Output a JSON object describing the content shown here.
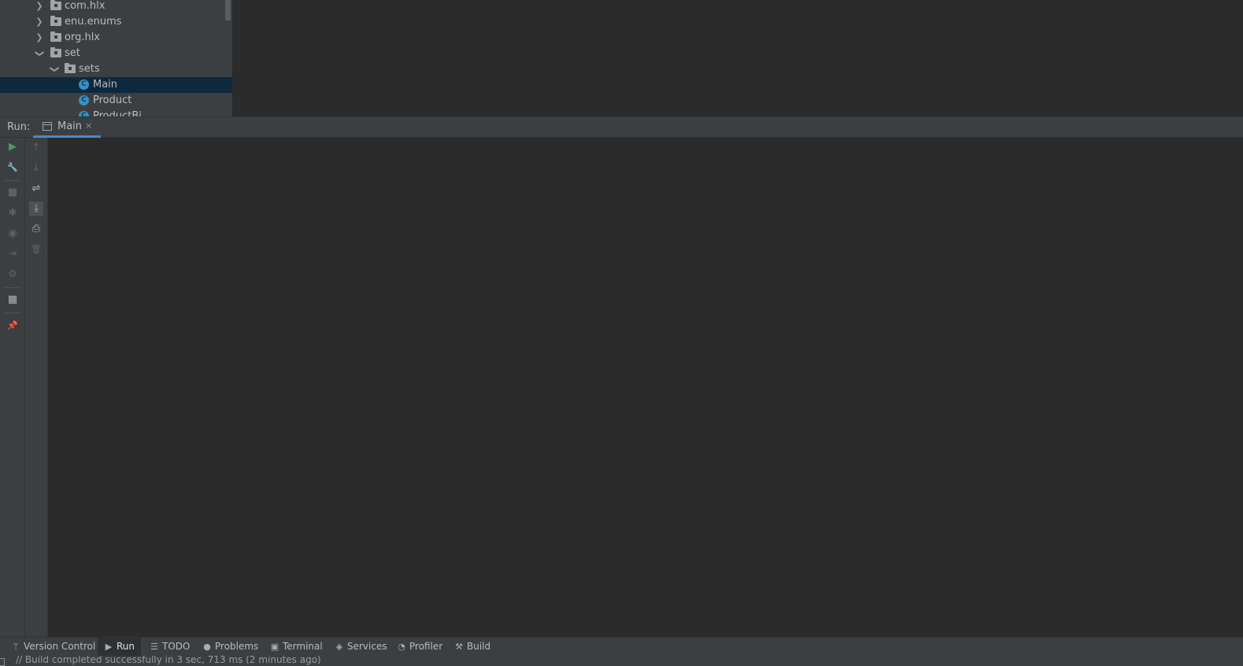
{
  "project_tree": {
    "items": [
      {
        "label": "com.hlx",
        "kind": "package",
        "expanded": false
      },
      {
        "label": "enu.enums",
        "kind": "package",
        "expanded": false
      },
      {
        "label": "org.hlx",
        "kind": "package",
        "expanded": false
      },
      {
        "label": "set",
        "kind": "package",
        "expanded": true
      },
      {
        "label": "sets",
        "kind": "package",
        "expanded": true
      },
      {
        "label": "Main",
        "kind": "class",
        "selected": true
      },
      {
        "label": "Product",
        "kind": "class"
      },
      {
        "label": "ProductBi",
        "kind": "class"
      }
    ]
  },
  "run_panel": {
    "label": "Run:",
    "tab": {
      "label": "Main",
      "close": "×"
    }
  },
  "toolbar_left": [
    {
      "icon": "run-icon",
      "glyph": "▶"
    },
    {
      "icon": "wrench-icon",
      "glyph": "🔧"
    },
    {
      "icon": "stop-icon",
      "glyph": "■"
    },
    {
      "icon": "debug-restart-icon",
      "glyph": "✱"
    },
    {
      "icon": "camera-icon",
      "glyph": "◉"
    },
    {
      "icon": "login-icon",
      "glyph": "⇥"
    },
    {
      "icon": "search-settings-icon",
      "glyph": "⚙"
    },
    {
      "icon": "layout-icon",
      "glyph": "▦"
    },
    {
      "icon": "pin-icon",
      "glyph": "📌"
    }
  ],
  "toolbar_right": [
    {
      "icon": "arrow-up-icon",
      "glyph": "↑"
    },
    {
      "icon": "arrow-down-icon",
      "glyph": "↓"
    },
    {
      "icon": "soft-wrap-icon",
      "glyph": "⇌"
    },
    {
      "icon": "scroll-to-end-icon",
      "glyph": "⤓"
    },
    {
      "icon": "print-icon",
      "glyph": "⎙"
    },
    {
      "icon": "trash-icon",
      "glyph": "🗑"
    }
  ],
  "bottom_bar": {
    "items": [
      {
        "label": "Version Control",
        "icon": "git-branch-icon",
        "glyph": "ᛘ"
      },
      {
        "label": "Run",
        "icon": "run-icon",
        "glyph": "▶",
        "active": true
      },
      {
        "label": "TODO",
        "icon": "list-icon",
        "glyph": "☰"
      },
      {
        "label": "Problems",
        "icon": "info-icon",
        "glyph": "●"
      },
      {
        "label": "Terminal",
        "icon": "terminal-icon",
        "glyph": "▣"
      },
      {
        "label": "Services",
        "icon": "services-icon",
        "glyph": "◈"
      },
      {
        "label": "Profiler",
        "icon": "profiler-icon",
        "glyph": "◔"
      },
      {
        "label": "Build",
        "icon": "hammer-icon",
        "glyph": "⚒"
      }
    ]
  },
  "status_bar": {
    "message": "// Build completed successfully in 3 sec, 713 ms (2 minutes ago)"
  },
  "colors": {
    "background": "#2b2b2b",
    "panel": "#3c3f41",
    "selection": "#0d293e",
    "accent": "#4a88c7",
    "run_green": "#499c54"
  }
}
